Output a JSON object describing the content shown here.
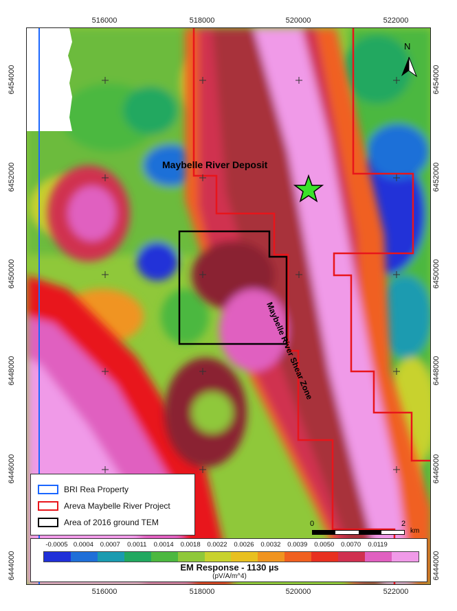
{
  "axes": {
    "x_ticks": [
      "516000",
      "518000",
      "520000",
      "522000"
    ],
    "y_ticks": [
      "6454000",
      "6452000",
      "6450000",
      "6448000",
      "6446000",
      "6444000"
    ]
  },
  "labels": {
    "deposit": "Maybelle River Deposit",
    "shear_zone": "Maybelle River Shear Zone",
    "north": "N"
  },
  "legend": {
    "items": [
      {
        "label": "BRI Rea Property",
        "color": "#1a66ff"
      },
      {
        "label": "Areva Maybelle River Project",
        "color": "#e8151b"
      },
      {
        "label": "Area of 2016 ground TEM",
        "color": "#000000"
      }
    ]
  },
  "scalebar": {
    "start": "0",
    "end": "2",
    "unit": "km"
  },
  "colorbar": {
    "title": "EM Response - 1130 µs",
    "units": "(pV/A/m^4)",
    "values": [
      "-0.0005",
      "0.0004",
      "0.0007",
      "0.0011",
      "0.0014",
      "0.0018",
      "0.0022",
      "0.0026",
      "0.0032",
      "0.0039",
      "0.0050",
      "0.0070",
      "0.0119"
    ],
    "colors": [
      "#2030d8",
      "#1f6fd8",
      "#1a9bb0",
      "#22a860",
      "#4cb840",
      "#8fc83a",
      "#c8d22e",
      "#e8c020",
      "#f09420",
      "#f06020",
      "#e83020",
      "#d03050",
      "#e060c0",
      "#f09ae8"
    ]
  }
}
